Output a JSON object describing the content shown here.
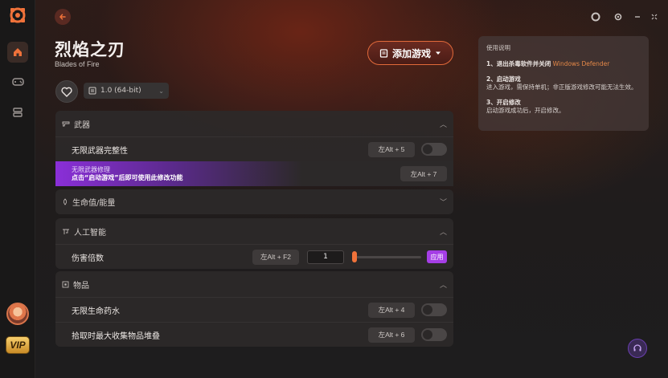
{
  "app": {
    "vip_label": "VIP"
  },
  "game": {
    "title": "烈焰之刃",
    "subtitle": "Blades of Fire",
    "add_game_label": "添加游戏",
    "version": "1.0 (64-bit)"
  },
  "sections": {
    "weapons": {
      "title": "武器",
      "rows": [
        {
          "label": "无限武器完整性",
          "hotkey": "左Alt + 5"
        }
      ],
      "locked": {
        "label": "无限武器修理",
        "notice": "点击“启动游戏”后即可使用此修改功能",
        "hotkey": "左Alt + 7"
      }
    },
    "health": {
      "title": "生命值/能量"
    },
    "ai": {
      "title": "人工智能",
      "damage": {
        "label": "伤害倍数",
        "hotkey": "左Alt + F2",
        "value": "1",
        "slider_level": 0,
        "apply_label": "应用"
      }
    },
    "items": {
      "title": "物品",
      "rows": [
        {
          "label": "无限生命药水",
          "hotkey": "左Alt + 4"
        },
        {
          "label": "拾取时最大收集物品堆叠",
          "hotkey": "左Alt + 6"
        }
      ]
    }
  },
  "instructions": {
    "title": "使用说明",
    "step1_title": "1、退出杀毒软件并关闭",
    "step1_highlight": "Windows Defender",
    "step2_title": "2、启动游戏",
    "step2_body": "进入游戏，需保持单机；非正版游戏修改可能无法生效。",
    "step3_title": "3、开启修改",
    "step3_body": "启动游戏成功后，开启修改。"
  },
  "colors": {
    "accent": "#f0723a",
    "purple": "#a53ee6"
  }
}
